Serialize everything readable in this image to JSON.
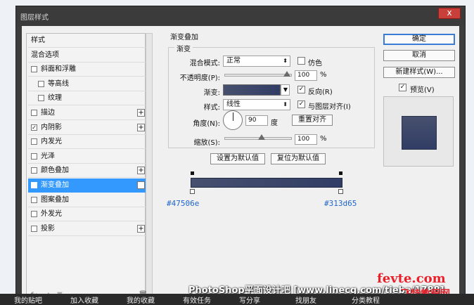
{
  "window": {
    "title": "图层样式",
    "close_label": "x"
  },
  "left_panel": {
    "items": [
      {
        "label": "样式",
        "checkbox": false,
        "checked": false,
        "plus": false,
        "active": false,
        "indent": 0
      },
      {
        "label": "混合选项",
        "checkbox": false,
        "checked": false,
        "plus": false,
        "active": false,
        "indent": 0
      },
      {
        "label": "斜面和浮雕",
        "checkbox": true,
        "checked": false,
        "plus": false,
        "active": false,
        "indent": 0
      },
      {
        "label": "等高线",
        "checkbox": true,
        "checked": false,
        "plus": false,
        "active": false,
        "indent": 1
      },
      {
        "label": "纹理",
        "checkbox": true,
        "checked": false,
        "plus": false,
        "active": false,
        "indent": 1
      },
      {
        "label": "描边",
        "checkbox": true,
        "checked": false,
        "plus": true,
        "active": false,
        "indent": 0
      },
      {
        "label": "内阴影",
        "checkbox": true,
        "checked": true,
        "plus": true,
        "active": false,
        "indent": 0
      },
      {
        "label": "内发光",
        "checkbox": true,
        "checked": false,
        "plus": false,
        "active": false,
        "indent": 0
      },
      {
        "label": "光泽",
        "checkbox": true,
        "checked": false,
        "plus": false,
        "active": false,
        "indent": 0
      },
      {
        "label": "颜色叠加",
        "checkbox": true,
        "checked": false,
        "plus": true,
        "active": false,
        "indent": 0
      },
      {
        "label": "渐变叠加",
        "checkbox": true,
        "checked": true,
        "plus": true,
        "active": true,
        "indent": 0
      },
      {
        "label": "图案叠加",
        "checkbox": true,
        "checked": false,
        "plus": false,
        "active": false,
        "indent": 0
      },
      {
        "label": "外发光",
        "checkbox": true,
        "checked": false,
        "plus": false,
        "active": false,
        "indent": 0
      },
      {
        "label": "投影",
        "checkbox": true,
        "checked": false,
        "plus": true,
        "active": false,
        "indent": 0
      }
    ],
    "fx_label": "fx",
    "trash_icon": "trash-icon"
  },
  "gradient_overlay": {
    "group_title": "渐变叠加",
    "sub_title": "渐变",
    "blend_mode_label": "混合模式:",
    "blend_mode_value": "正常",
    "dither_label": "仿色",
    "dither_checked": false,
    "opacity_label": "不透明度(P):",
    "opacity_value": "100",
    "opacity_unit": "%",
    "gradient_label": "渐变:",
    "reverse_label": "反向(R)",
    "reverse_checked": true,
    "style_label": "样式:",
    "style_value": "线性",
    "align_label": "与图层对齐(I)",
    "align_checked": true,
    "angle_label": "角度(N):",
    "angle_value": "90",
    "angle_unit": "度",
    "reset_align_label": "重置对齐",
    "scale_label": "缩放(S):",
    "scale_value": "100",
    "scale_unit": "%",
    "set_default_label": "设置为默认值",
    "reset_default_label": "复位为默认值"
  },
  "gradient_bar": {
    "left_hex": "#47506e",
    "right_hex": "#313d65",
    "left_color": "#47506e",
    "right_color": "#313d65"
  },
  "right_buttons": {
    "ok_label": "确定",
    "cancel_label": "取消",
    "new_style_label": "新建样式(W)...",
    "preview_label": "预览(V)",
    "preview_checked": true
  },
  "watermark": {
    "text": "PhotoShop平面设计吧 [www.linecg.com/tieba/1788]",
    "logo_top": "fevte.com",
    "logo_bottom": "飞特教程网"
  },
  "bottom_strip": {
    "items": [
      "我的贴吧",
      "加入收藏",
      "我的收藏",
      "有效任务",
      "写分享",
      "找朋友",
      "分类教程"
    ]
  }
}
